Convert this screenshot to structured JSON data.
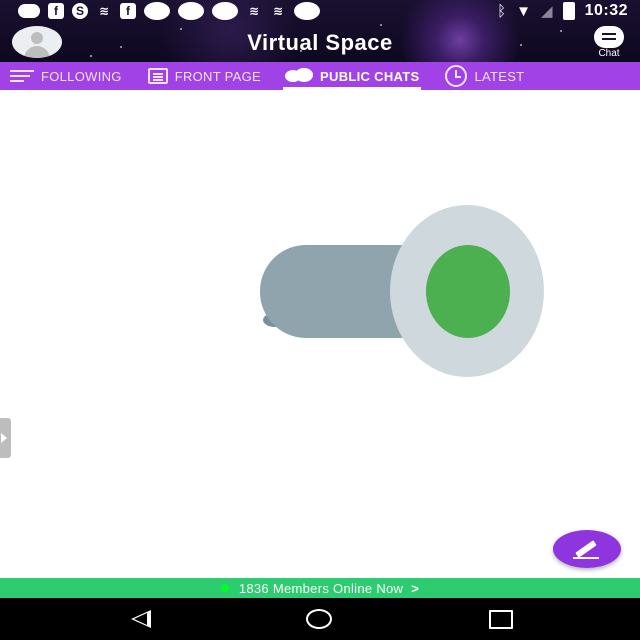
{
  "status_bar": {
    "time": "10:32",
    "icons": [
      "message-icon",
      "facebook-icon",
      "s-app-icon",
      "signal-app-icon",
      "facebook-icon",
      "circle-icon",
      "circle-icon",
      "circle-icon",
      "signal-app-icon",
      "signal-app-icon",
      "circle-icon",
      "bluetooth-icon",
      "wifi-icon",
      "no-signal-icon",
      "battery-charging-icon"
    ]
  },
  "header": {
    "title": "Virtual Space",
    "chat_label": "Chat"
  },
  "tabs": [
    {
      "label": "FOLLOWING",
      "icon": "list-icon",
      "active": false
    },
    {
      "label": "FRONT PAGE",
      "icon": "document-icon",
      "active": false
    },
    {
      "label": "PUBLIC CHATS",
      "icon": "chat-bubbles-icon",
      "active": true
    },
    {
      "label": "LATEST",
      "icon": "clock-icon",
      "active": false
    }
  ],
  "footer": {
    "online_text": "1836 Members Online Now",
    "arrow": ">"
  },
  "colors": {
    "tab_bar": "#a042e6",
    "fab": "#8e35e0",
    "online_bar": "#2ecc71",
    "loader_green": "#4caf50"
  }
}
